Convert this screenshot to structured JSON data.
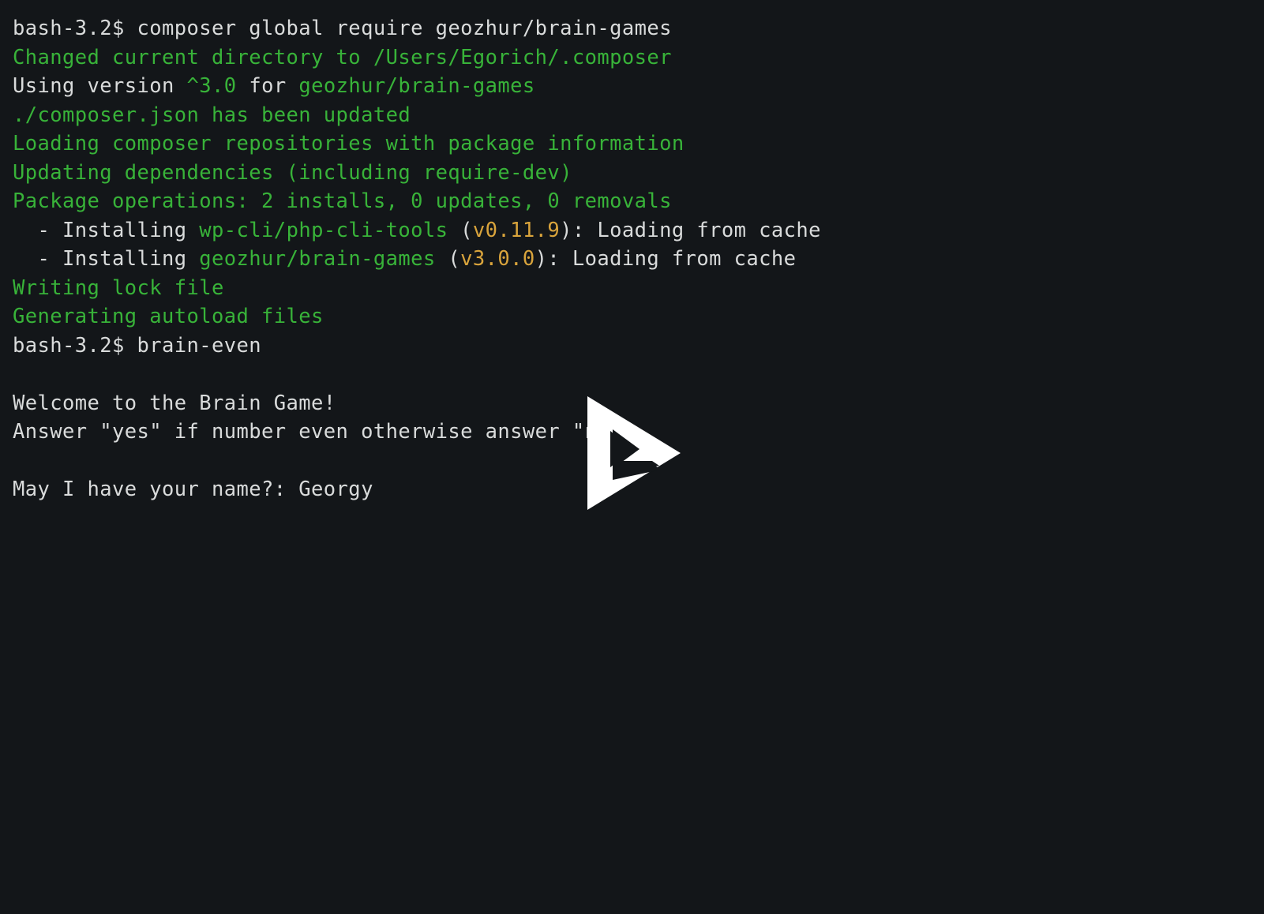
{
  "terminal": {
    "background_color": "#131619",
    "text_color": "#d9dbdb",
    "green_color": "#38b339",
    "yellow_color": "#d9a43c",
    "lines": [
      {
        "id": "l1",
        "segments": [
          {
            "text": "bash-3.2$ composer global require geozhur/brain-games",
            "color": "white"
          }
        ]
      },
      {
        "id": "l2",
        "segments": [
          {
            "text": "Changed current directory to /Users/Egorich/.composer",
            "color": "green"
          }
        ]
      },
      {
        "id": "l3",
        "segments": [
          {
            "text": "Using version ",
            "color": "white"
          },
          {
            "text": "^3.0",
            "color": "green"
          },
          {
            "text": " for ",
            "color": "white"
          },
          {
            "text": "geozhur/brain-games",
            "color": "green"
          }
        ]
      },
      {
        "id": "l4",
        "segments": [
          {
            "text": "./composer.json has been updated",
            "color": "green"
          }
        ]
      },
      {
        "id": "l5",
        "segments": [
          {
            "text": "Loading composer repositories with package information",
            "color": "green"
          }
        ]
      },
      {
        "id": "l6",
        "segments": [
          {
            "text": "Updating dependencies (including require-dev)",
            "color": "green"
          }
        ]
      },
      {
        "id": "l7",
        "segments": [
          {
            "text": "Package operations: 2 installs, 0 updates, 0 removals",
            "color": "green"
          }
        ]
      },
      {
        "id": "l8",
        "segments": [
          {
            "text": "  - Installing ",
            "color": "white"
          },
          {
            "text": "wp-cli/php-cli-tools",
            "color": "green"
          },
          {
            "text": " (",
            "color": "white"
          },
          {
            "text": "v0.11.9",
            "color": "yellow"
          },
          {
            "text": "): Loading from cache",
            "color": "white"
          }
        ]
      },
      {
        "id": "l9",
        "segments": [
          {
            "text": "  - Installing ",
            "color": "white"
          },
          {
            "text": "geozhur/brain-games",
            "color": "green"
          },
          {
            "text": " (",
            "color": "white"
          },
          {
            "text": "v3.0.0",
            "color": "yellow"
          },
          {
            "text": "): Loading from cache",
            "color": "white"
          }
        ]
      },
      {
        "id": "l10",
        "segments": [
          {
            "text": "Writing lock file",
            "color": "green"
          }
        ]
      },
      {
        "id": "l11",
        "segments": [
          {
            "text": "Generating autoload files",
            "color": "green"
          }
        ]
      },
      {
        "id": "l12",
        "segments": [
          {
            "text": "bash-3.2$ brain-even",
            "color": "white"
          }
        ]
      },
      {
        "id": "l13",
        "segments": [
          {
            "text": " ",
            "color": "white"
          }
        ]
      },
      {
        "id": "l14",
        "segments": [
          {
            "text": "Welcome to the Brain Game!",
            "color": "white"
          }
        ]
      },
      {
        "id": "l15",
        "segments": [
          {
            "text": "Answer \"yes\" if number even otherwise answer \"no\"",
            "color": "white"
          }
        ]
      },
      {
        "id": "l16",
        "segments": [
          {
            "text": " ",
            "color": "white"
          }
        ]
      },
      {
        "id": "l17",
        "segments": [
          {
            "text": "May I have your name?: Georgy",
            "color": "white"
          }
        ]
      }
    ]
  },
  "overlay": {
    "play_button_label": "Play",
    "play_button_color": "#ffffff"
  }
}
